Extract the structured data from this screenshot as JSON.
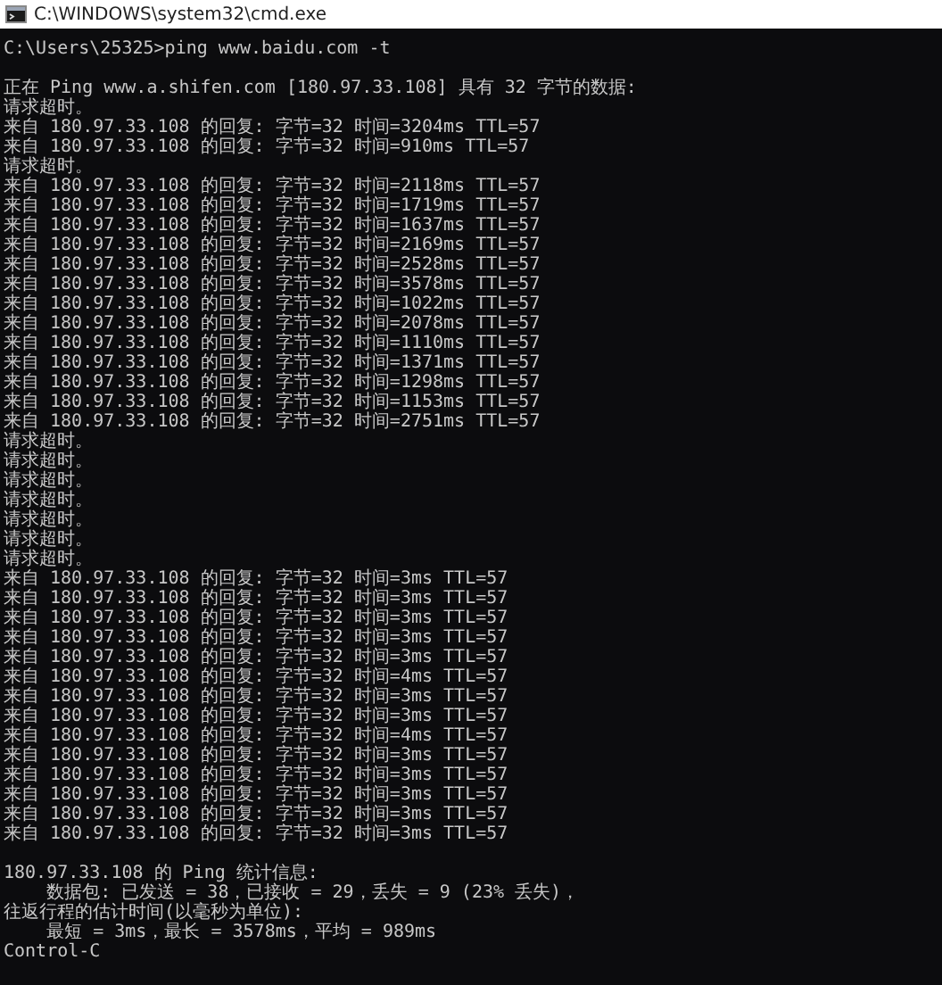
{
  "window": {
    "title": "C:\\WINDOWS\\system32\\cmd.exe"
  },
  "console": {
    "blocks": [
      {
        "lines": [
          "C:\\Users\\25325>ping www.baidu.com -t"
        ]
      },
      {
        "lines": [
          "正在 Ping www.a.shifen.com [180.97.33.108] 具有 32 字节的数据:",
          "请求超时。",
          "来自 180.97.33.108 的回复: 字节=32 时间=3204ms TTL=57",
          "来自 180.97.33.108 的回复: 字节=32 时间=910ms TTL=57",
          "请求超时。",
          "来自 180.97.33.108 的回复: 字节=32 时间=2118ms TTL=57",
          "来自 180.97.33.108 的回复: 字节=32 时间=1719ms TTL=57",
          "来自 180.97.33.108 的回复: 字节=32 时间=1637ms TTL=57",
          "来自 180.97.33.108 的回复: 字节=32 时间=2169ms TTL=57",
          "来自 180.97.33.108 的回复: 字节=32 时间=2528ms TTL=57",
          "来自 180.97.33.108 的回复: 字节=32 时间=3578ms TTL=57",
          "来自 180.97.33.108 的回复: 字节=32 时间=1022ms TTL=57",
          "来自 180.97.33.108 的回复: 字节=32 时间=2078ms TTL=57",
          "来自 180.97.33.108 的回复: 字节=32 时间=1110ms TTL=57",
          "来自 180.97.33.108 的回复: 字节=32 时间=1371ms TTL=57",
          "来自 180.97.33.108 的回复: 字节=32 时间=1298ms TTL=57",
          "来自 180.97.33.108 的回复: 字节=32 时间=1153ms TTL=57",
          "来自 180.97.33.108 的回复: 字节=32 时间=2751ms TTL=57",
          "请求超时。",
          "请求超时。",
          "请求超时。",
          "请求超时。",
          "请求超时。",
          "请求超时。",
          "请求超时。",
          "来自 180.97.33.108 的回复: 字节=32 时间=3ms TTL=57",
          "来自 180.97.33.108 的回复: 字节=32 时间=3ms TTL=57",
          "来自 180.97.33.108 的回复: 字节=32 时间=3ms TTL=57",
          "来自 180.97.33.108 的回复: 字节=32 时间=3ms TTL=57",
          "来自 180.97.33.108 的回复: 字节=32 时间=3ms TTL=57",
          "来自 180.97.33.108 的回复: 字节=32 时间=4ms TTL=57",
          "来自 180.97.33.108 的回复: 字节=32 时间=3ms TTL=57",
          "来自 180.97.33.108 的回复: 字节=32 时间=3ms TTL=57",
          "来自 180.97.33.108 的回复: 字节=32 时间=4ms TTL=57",
          "来自 180.97.33.108 的回复: 字节=32 时间=3ms TTL=57",
          "来自 180.97.33.108 的回复: 字节=32 时间=3ms TTL=57",
          "来自 180.97.33.108 的回复: 字节=32 时间=3ms TTL=57",
          "来自 180.97.33.108 的回复: 字节=32 时间=3ms TTL=57",
          "来自 180.97.33.108 的回复: 字节=32 时间=3ms TTL=57"
        ]
      },
      {
        "lines": [
          "180.97.33.108 的 Ping 统计信息:",
          "    数据包: 已发送 = 38，已接收 = 29，丢失 = 9 (23% 丢失)，",
          "往返行程的估计时间(以毫秒为单位):",
          "    最短 = 3ms，最长 = 3578ms，平均 = 989ms",
          "Control-C"
        ]
      }
    ]
  }
}
